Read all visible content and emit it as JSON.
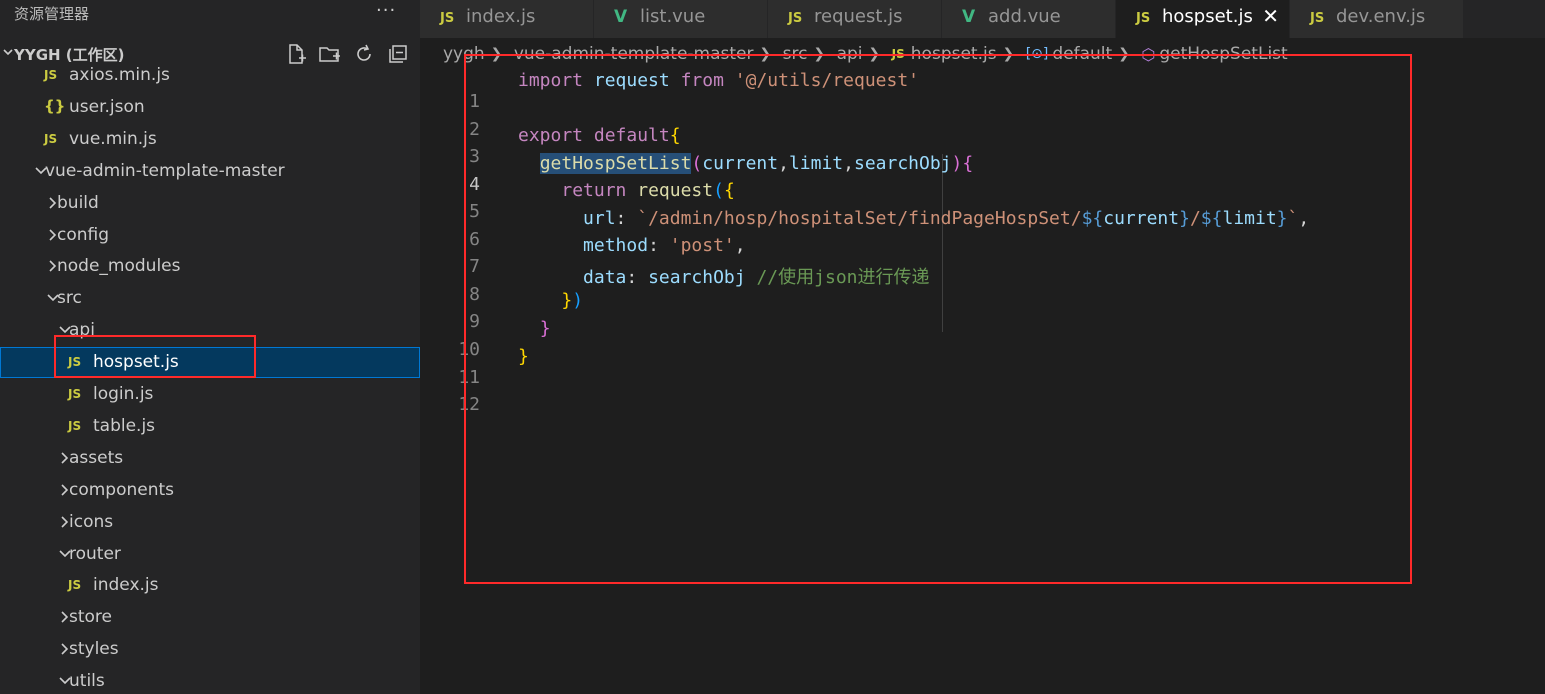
{
  "explorer": {
    "title": "资源管理器",
    "more": "···",
    "workspace": "YYGH (工作区)"
  },
  "tree": [
    {
      "label": "axios.min.js",
      "icon": "JS",
      "type": "file"
    },
    {
      "label": "user.json",
      "icon": "{}",
      "type": "json"
    },
    {
      "label": "vue.min.js",
      "icon": "JS",
      "type": "file"
    },
    {
      "label": "vue-admin-template-master",
      "type": "folder-open"
    },
    {
      "label": "build",
      "type": "folder"
    },
    {
      "label": "config",
      "type": "folder"
    },
    {
      "label": "node_modules",
      "type": "folder"
    },
    {
      "label": "src",
      "type": "folder-open"
    },
    {
      "label": "api",
      "type": "folder-open"
    },
    {
      "label": "hospset.js",
      "icon": "JS",
      "type": "file",
      "selected": true
    },
    {
      "label": "login.js",
      "icon": "JS",
      "type": "file"
    },
    {
      "label": "table.js",
      "icon": "JS",
      "type": "file"
    },
    {
      "label": "assets",
      "type": "folder"
    },
    {
      "label": "components",
      "type": "folder"
    },
    {
      "label": "icons",
      "type": "folder"
    },
    {
      "label": "router",
      "type": "folder-open"
    },
    {
      "label": "index.js",
      "icon": "JS",
      "type": "file"
    },
    {
      "label": "store",
      "type": "folder"
    },
    {
      "label": "styles",
      "type": "folder"
    },
    {
      "label": "utils",
      "type": "folder-open"
    }
  ],
  "tabs": [
    {
      "label": "index.js",
      "icon": "JS"
    },
    {
      "label": "list.vue",
      "icon": "V"
    },
    {
      "label": "request.js",
      "icon": "JS"
    },
    {
      "label": "add.vue",
      "icon": "V"
    },
    {
      "label": "hospset.js",
      "icon": "JS",
      "active": true,
      "close": "✕"
    },
    {
      "label": "dev.env.js",
      "icon": "JS"
    }
  ],
  "breadcrumb": {
    "items": [
      "yygh",
      "vue-admin-template-master",
      "src",
      "api"
    ],
    "file_icon": "JS",
    "file": "hospset.js",
    "symbol_icon": "[⊙]",
    "symbol": "default",
    "method_icon": "⬡",
    "method": "getHospSetList"
  },
  "code": {
    "line_numbers": [
      "1",
      "2",
      "3",
      "4",
      "5",
      "6",
      "7",
      "8",
      "9",
      "10",
      "11",
      "12"
    ],
    "current_line": "4",
    "l1": {
      "kw": "import",
      "id": "request",
      "kw2": "from",
      "str": "'@/utils/request'"
    },
    "l3": {
      "kw": "export",
      "kw2": "default",
      "brace": "{"
    },
    "l4": {
      "fn": "getHospSetList",
      "open": "(",
      "p1": "current",
      "c1": ",",
      "p2": "limit",
      "c2": ",",
      "p3": "searchObj",
      "close": ")",
      "brace": "{"
    },
    "l5": {
      "kw": "return",
      "fn": "request",
      "open": "(",
      "brace": "{"
    },
    "l6": {
      "key": "url",
      "colon": ": ",
      "s1": "`/admin/hosp/hospitalSet/findPageHospSet/",
      "d1": "${",
      "v1": "current",
      "e1": "}",
      "s2": "/",
      "d2": "${",
      "v2": "limit",
      "e2": "}",
      "s3": "`",
      "comma": ","
    },
    "l7": {
      "key": "method",
      "colon": ": ",
      "str": "'post'",
      "comma": ","
    },
    "l8": {
      "key": "data",
      "colon": ": ",
      "id": "searchObj",
      "cmt": "//使用json进行传递"
    },
    "l9": {
      "brace": "}",
      "close": ")"
    },
    "l10": {
      "brace": "}"
    },
    "l11": {
      "brace": "}"
    }
  },
  "colors": {
    "annotation": "#ff2a2a",
    "selection": "#04395e"
  }
}
